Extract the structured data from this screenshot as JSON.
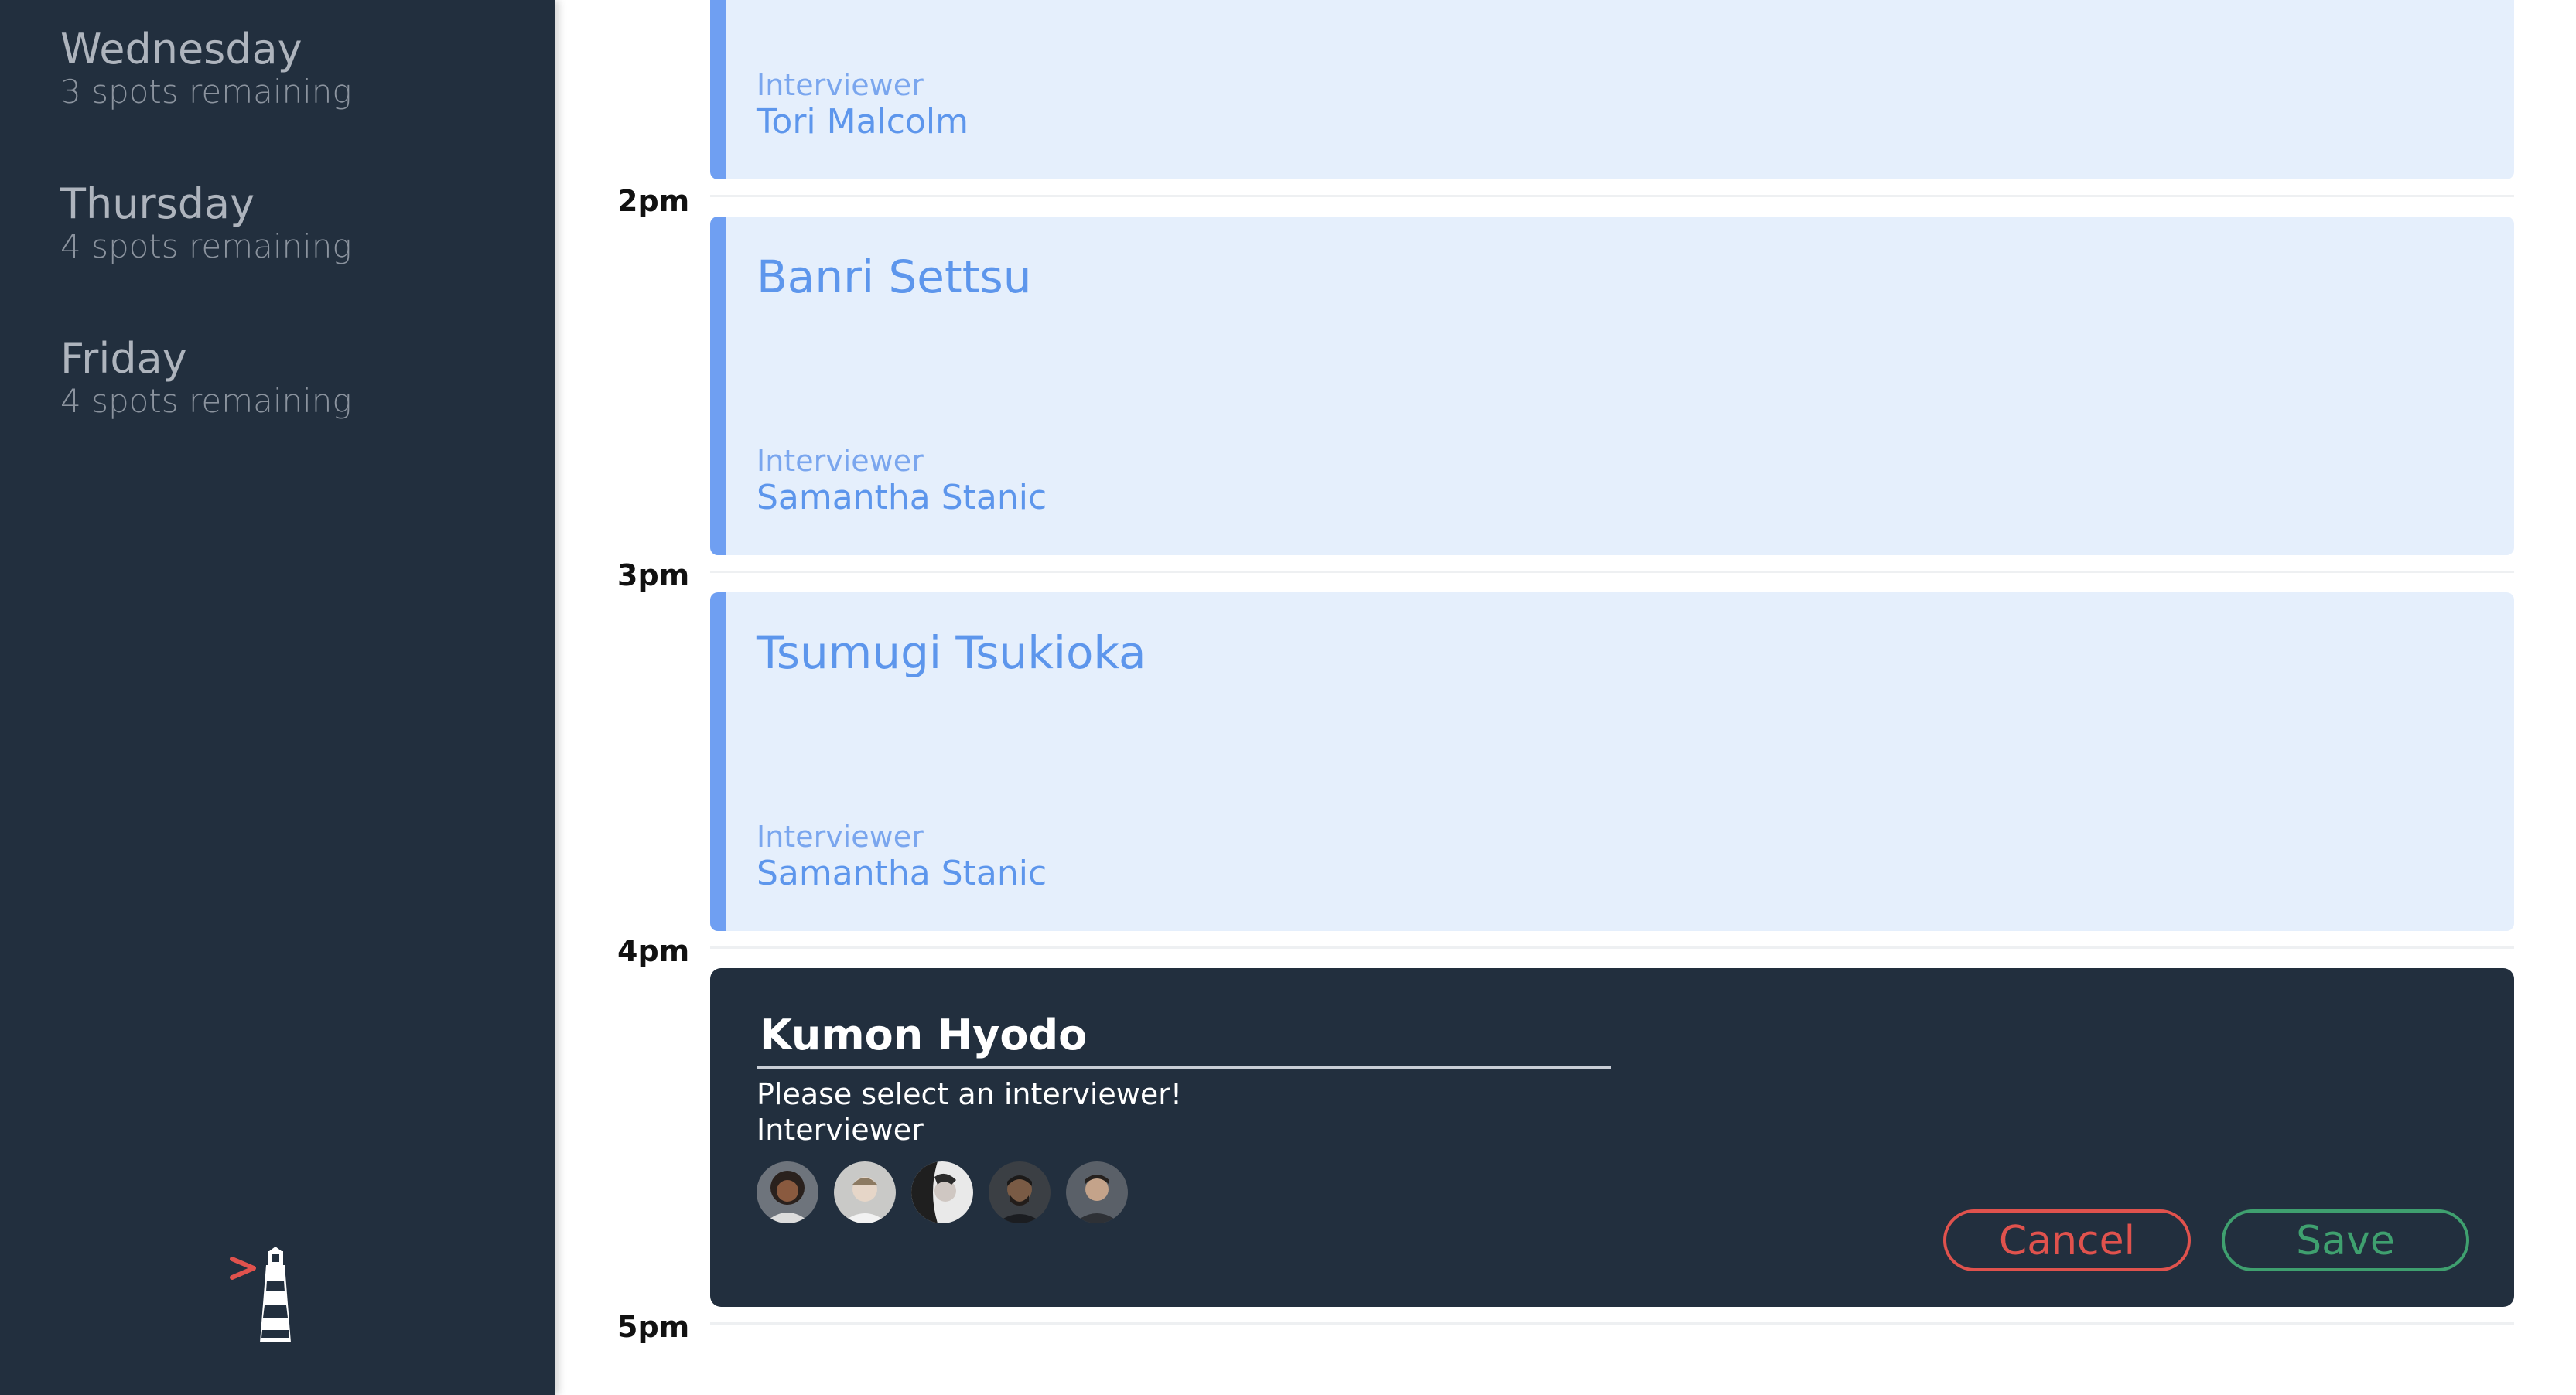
{
  "sidebar": {
    "days": [
      {
        "name": "Wednesday",
        "spots": "3 spots remaining"
      },
      {
        "name": "Thursday",
        "spots": "4 spots remaining"
      },
      {
        "name": "Friday",
        "spots": "4 spots remaining"
      }
    ],
    "logo_icon": "lighthouse-icon"
  },
  "schedule": {
    "times": [
      "2pm",
      "3pm",
      "4pm",
      "5pm"
    ],
    "appointments": [
      {
        "student": "",
        "interviewer_label": "Interviewer",
        "interviewer": "Tori Malcolm"
      },
      {
        "student": "Banri Settsu",
        "interviewer_label": "Interviewer",
        "interviewer": "Samantha Stanic"
      },
      {
        "student": "Tsumugi Tsukioka",
        "interviewer_label": "Interviewer",
        "interviewer": "Samantha Stanic"
      }
    ],
    "form": {
      "student_name": "Kumon Hyodo",
      "validation": "Please select an interviewer!",
      "interviewer_label": "Interviewer",
      "interviewers_icons": [
        "avatar-icon",
        "avatar-icon",
        "avatar-icon",
        "avatar-icon",
        "avatar-icon"
      ],
      "cancel_label": "Cancel",
      "save_label": "Save"
    }
  },
  "colors": {
    "sidebar_bg": "#222f3e",
    "appointment_bg": "#e5effc",
    "appointment_accent": "#6f9ff2",
    "cancel": "#e0524d",
    "save": "#3fa06f"
  }
}
